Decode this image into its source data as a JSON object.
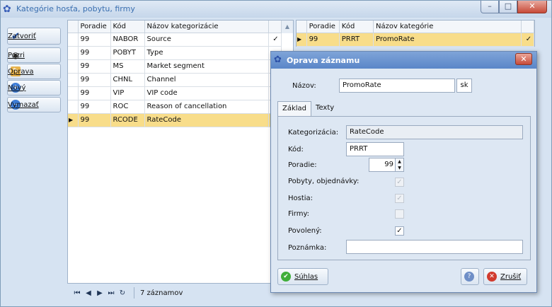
{
  "window": {
    "title": "Kategórie hosťa, pobytu, firmy",
    "controls": {
      "minimize": "–",
      "maximize": "□",
      "close": "✕"
    }
  },
  "toolbar": {
    "close": "Zatvoriť",
    "preview": "Pozri",
    "edit": "Oprava",
    "new": "Nový",
    "delete": "Vymazať"
  },
  "left_grid": {
    "columns": [
      "Poradie",
      "Kód",
      "Názov kategorizácie"
    ],
    "rows": [
      {
        "order": "99",
        "code": "NABOR",
        "name": "Source",
        "check": "✓",
        "selected": false
      },
      {
        "order": "99",
        "code": "POBYT",
        "name": "Type",
        "check": "",
        "selected": false
      },
      {
        "order": "99",
        "code": "MS",
        "name": "Market segment",
        "check": "",
        "selected": false
      },
      {
        "order": "99",
        "code": "CHNL",
        "name": "Channel",
        "check": "",
        "selected": false
      },
      {
        "order": "99",
        "code": "VIP",
        "name": "VIP code",
        "check": "",
        "selected": false
      },
      {
        "order": "99",
        "code": "ROC",
        "name": "Reason of cancellation",
        "check": "",
        "selected": false
      },
      {
        "order": "99",
        "code": "RCODE",
        "name": "RateCode",
        "check": "",
        "selected": true
      }
    ]
  },
  "right_grid": {
    "columns": [
      "Poradie",
      "Kód",
      "Názov kategórie"
    ],
    "rows": [
      {
        "order": "99",
        "code": "PRRT",
        "name": "PromoRate",
        "check": "✓",
        "selected": true
      }
    ]
  },
  "navigator": {
    "record_count": "7 záznamov"
  },
  "dialog": {
    "title": "Oprava záznamu",
    "close": "✕",
    "name_label": "Názov:",
    "name_value": "PromoRate",
    "lang_button": "sk",
    "tabs": [
      "Základ",
      "Texty"
    ],
    "fields": {
      "category_label": "Kategorizácia:",
      "category_value": "RateCode",
      "code_label": "Kód:",
      "code_value": "PRRT",
      "order_label": "Poradie:",
      "order_value": "99",
      "stays_label": "Pobyty, objednávky:",
      "guests_label": "Hostia:",
      "companies_label": "Firmy:",
      "allowed_label": "Povolený:",
      "note_label": "Poznámka:",
      "note_value": ""
    },
    "checks": {
      "stays": "✓",
      "guests": "✓",
      "companies": "",
      "allowed": "✓"
    },
    "ok_button": "Súhlas",
    "help_button": "?",
    "cancel_button": "Zrušiť"
  }
}
